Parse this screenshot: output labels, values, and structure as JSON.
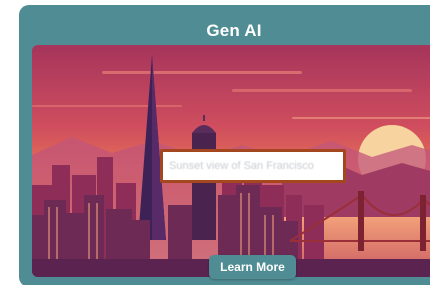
{
  "card": {
    "title": "Gen AI",
    "accent_color": "#4f8c93"
  },
  "image": {
    "semantic": "sunset-city-illustration"
  },
  "prompt": {
    "text": "Sunset view of San Francisco"
  },
  "cta": {
    "label": "Learn More"
  }
}
